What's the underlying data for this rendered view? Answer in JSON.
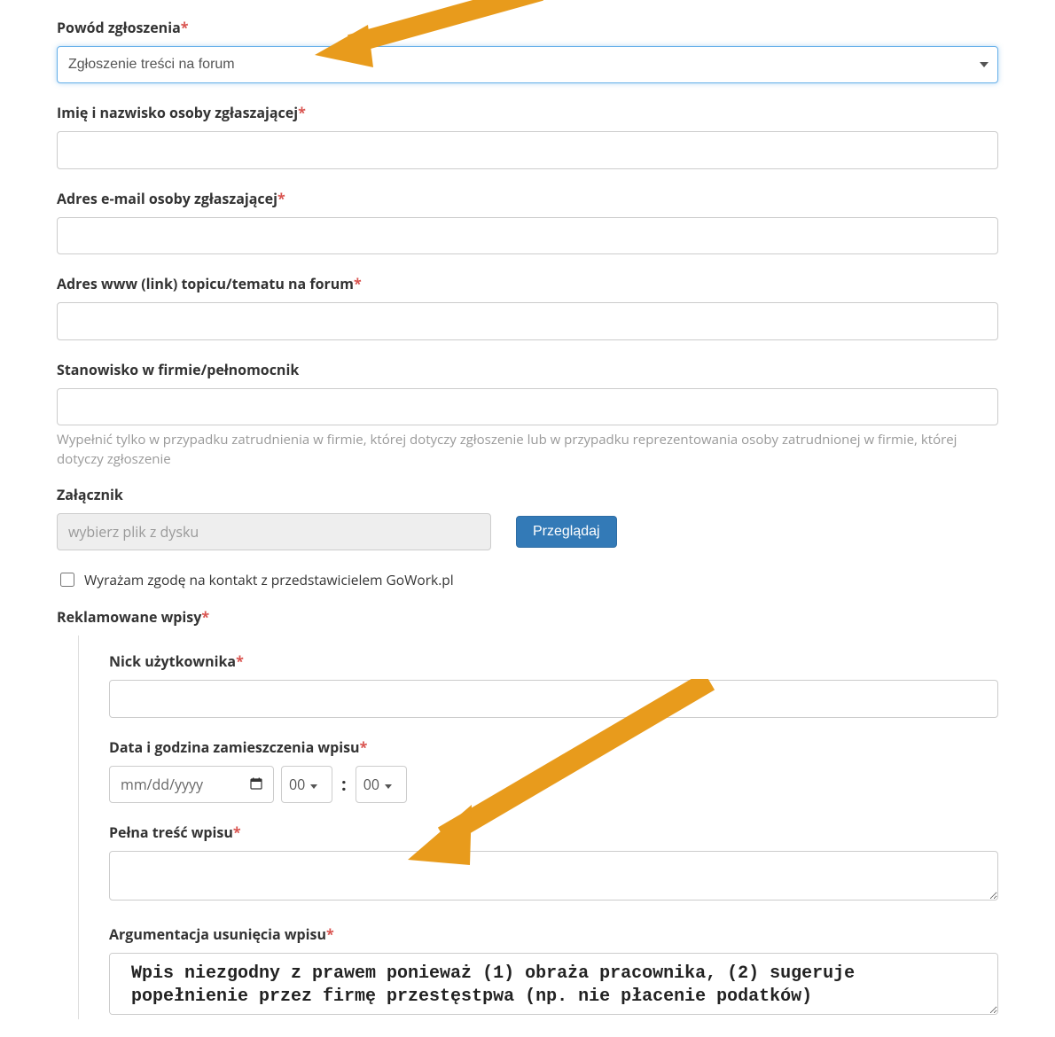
{
  "reason": {
    "label": "Powód zgłoszenia",
    "selected": "Zgłoszenie treści na forum"
  },
  "name": {
    "label": "Imię i nazwisko osoby zgłaszającej",
    "value": ""
  },
  "email": {
    "label": "Adres e-mail osoby zgłaszającej",
    "value": ""
  },
  "url": {
    "label": "Adres www (link) topicu/tematu na forum",
    "value": ""
  },
  "position": {
    "label": "Stanowisko w firmie/pełnomocnik",
    "value": "",
    "help": "Wypełnić tylko w przypadku zatrudnienia w firmie, której dotyczy zgłoszenie lub w przypadku reprezentowania osoby zatrudnionej w firmie, której dotyczy zgłoszenie"
  },
  "attachment": {
    "label": "Załącznik",
    "placeholder": "wybierz plik z dysku",
    "browse": "Przeglądaj"
  },
  "consent": {
    "label": "Wyrażam zgodę na kontakt z przedstawicielem GoWork.pl"
  },
  "entries": {
    "label": "Reklamowane wpisy",
    "nick": {
      "label": "Nick użytkownika",
      "value": ""
    },
    "datetime": {
      "label": "Data i godzina zamieszczenia wpisu",
      "date_placeholder": "mm/dd/yyyy",
      "hour": "00",
      "minute": "00"
    },
    "fulltext": {
      "label": "Pełna treść wpisu",
      "value": ""
    },
    "argument": {
      "label": "Argumentacja usunięcia wpisu",
      "value": "Wpis niezgodny z prawem ponieważ (1) obraża pracownika, (2) sugeruje popełnienie przez firmę przestęstpwa (np. nie płacenie podatków)"
    }
  }
}
